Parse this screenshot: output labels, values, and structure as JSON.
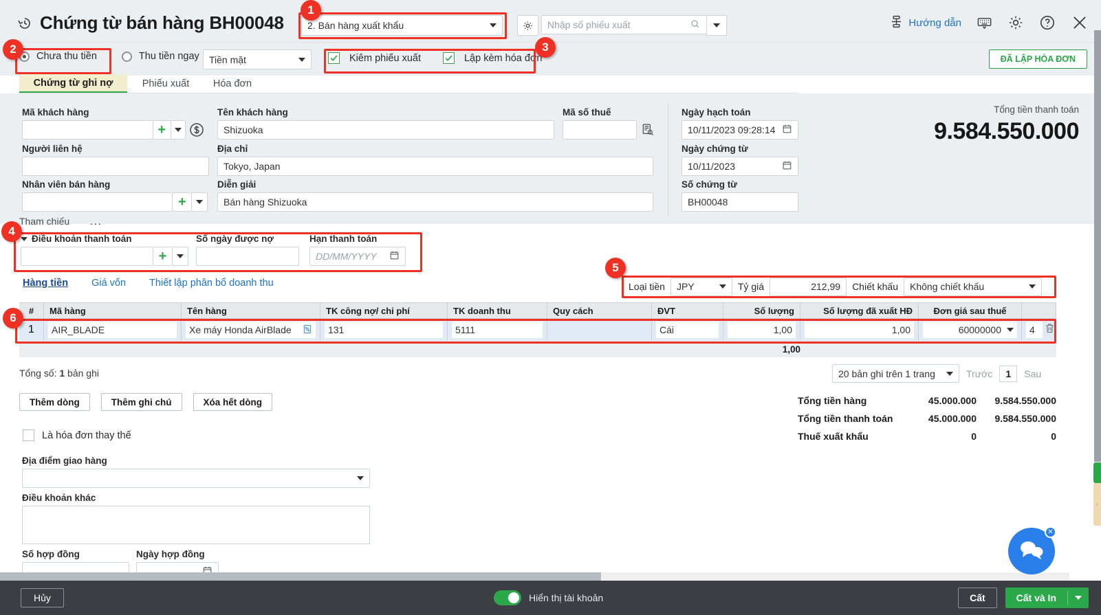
{
  "header": {
    "title": "Chứng từ bán hàng BH00048",
    "history_icon": "history-clock-icon",
    "doc_type_value": "2. Bán hàng xuất khẩu",
    "gear_icon": "gear-icon",
    "export_search_placeholder": "Nhập số phiếu xuất",
    "search_icon": "search-icon",
    "guide_label": "Hướng dẫn",
    "guide_icon": "guide-flow-icon",
    "keyboard_icon": "keyboard-icon",
    "settings_icon": "settings-gear-icon",
    "help_icon": "question-circle-icon",
    "close_icon": "close-x-icon"
  },
  "payment_row": {
    "radio_unpaid": "Chưa thu tiền",
    "radio_paid_now": "Thu tiền ngay",
    "method_value": "Tiền mặt",
    "check_export_slip": "Kiêm phiếu xuất",
    "check_with_invoice": "Lập kèm hóa đơn",
    "invoiced_badge": "ĐÃ LẬP HÓA ĐƠN"
  },
  "tabs": [
    {
      "label": "Chứng từ ghi nợ",
      "active": true
    },
    {
      "label": "Phiếu xuất",
      "active": false
    },
    {
      "label": "Hóa đơn",
      "active": false
    }
  ],
  "form": {
    "customer_code_label": "Mã khách hàng",
    "customer_code_value": "",
    "customer_name_label": "Tên khách hàng",
    "customer_name_value": "Shizuoka",
    "tax_code_label": "Mã số thuế",
    "tax_code_value": "",
    "tax_lookup_icon": "tax-lookup-icon",
    "money_icon": "dollar-circle-icon",
    "contact_label": "Người liên hệ",
    "contact_value": "",
    "address_label": "Địa chỉ",
    "address_value": "Tokyo, Japan",
    "salesperson_label": "Nhân viên bán hàng",
    "salesperson_value": "",
    "description_label": "Diễn giải",
    "description_value": "Bán hàng Shizuoka",
    "posting_date_label": "Ngày hạch toán",
    "posting_date_value": "10/11/2023 09:28:14",
    "doc_date_label": "Ngày chứng từ",
    "doc_date_value": "10/11/2023",
    "doc_no_label": "Số chứng từ",
    "doc_no_value": "BH00048",
    "calendar_icon": "calendar-icon",
    "total_payment_label": "Tổng tiền thanh toán",
    "total_payment_value": "9.584.550.000"
  },
  "reference": {
    "label": "Tham chiếu",
    "ellipsis": "..."
  },
  "payment_terms": {
    "terms_label": "Điều khoản thanh toán",
    "terms_value": "",
    "credit_days_label": "Số ngày được nợ",
    "credit_days_value": "",
    "due_date_label": "Hạn thanh toán",
    "due_date_placeholder": "DD/MM/YYYY"
  },
  "subtabs": [
    {
      "label": "Hàng tiền",
      "active": true
    },
    {
      "label": "Giá vốn",
      "active": false
    },
    {
      "label": "Thiết lập phân bổ doanh thu",
      "active": false
    }
  ],
  "currency_bar": {
    "currency_label": "Loại tiền",
    "currency_value": "JPY",
    "rate_label": "Tỷ giá",
    "rate_value": "212,99",
    "discount_label": "Chiết khấu",
    "discount_value": "Không chiết khấu"
  },
  "grid": {
    "columns": [
      "#",
      "Mã hàng",
      "Tên hàng",
      "TK công nợ/ chi phí",
      "TK doanh thu",
      "Quy cách",
      "ĐVT",
      "Số lượng",
      "Số lượng đã xuất HĐ",
      "Đơn giá sau thuế"
    ],
    "rows": [
      {
        "index": "1",
        "item_code": "AIR_BLADE",
        "item_name": "Xe máy Honda AirBlade",
        "item_name_icon": "percent-doc-icon",
        "debt_account": "131",
        "revenue_account": "5111",
        "spec": "",
        "unit": "Cái",
        "quantity": "1,00",
        "qty_invoiced": "1,00",
        "unit_price_after_tax": "60000000",
        "amount_partial": "4",
        "delete_icon": "trash-icon"
      }
    ],
    "footer_quantity": "1,00"
  },
  "below_grid": {
    "record_count_prefix": "Tổng số: ",
    "record_count_value": "1",
    "record_count_suffix": " bản ghi",
    "add_row": "Thêm dòng",
    "add_note": "Thêm ghi chú",
    "delete_all_rows": "Xóa hết dòng",
    "replacement_invoice": "Là hóa đơn thay thế",
    "delivery_place_label": "Địa điểm giao hàng",
    "delivery_place_value": "",
    "other_terms_label": "Điều khoản khác",
    "other_terms_value": "",
    "contract_no_label": "Số hợp đồng",
    "contract_date_label": "Ngày hợp đồng"
  },
  "pagination": {
    "per_page": "20 bản ghi trên 1 trang",
    "prev": "Trước",
    "page": "1",
    "next": "Sau"
  },
  "totals": [
    {
      "name": "Tổng tiền hàng",
      "v1": "45.000.000",
      "v2": "9.584.550.000"
    },
    {
      "name": "Tổng tiền thanh toán",
      "v1": "45.000.000",
      "v2": "9.584.550.000"
    },
    {
      "name": "Thuế xuất khẩu",
      "v1": "0",
      "v2": "0"
    }
  ],
  "footer": {
    "cancel": "Hủy",
    "show_account_toggle": "Hiển thị tài khoản",
    "save": "Cất",
    "save_print": "Cất và In"
  },
  "annotations": [
    {
      "n": "1"
    },
    {
      "n": "2"
    },
    {
      "n": "3"
    },
    {
      "n": "4"
    },
    {
      "n": "5"
    },
    {
      "n": "6"
    }
  ],
  "chat": {
    "icon": "chat-bubbles-icon",
    "close_icon": "close-small-icon"
  },
  "colors": {
    "accent_green": "#2aa84a",
    "link_blue": "#1a73c8",
    "annotation_red": "#ee3124",
    "chat_blue": "#2a7fea",
    "header_bg": "#eceff1",
    "row_selected": "#dfeaf5"
  }
}
